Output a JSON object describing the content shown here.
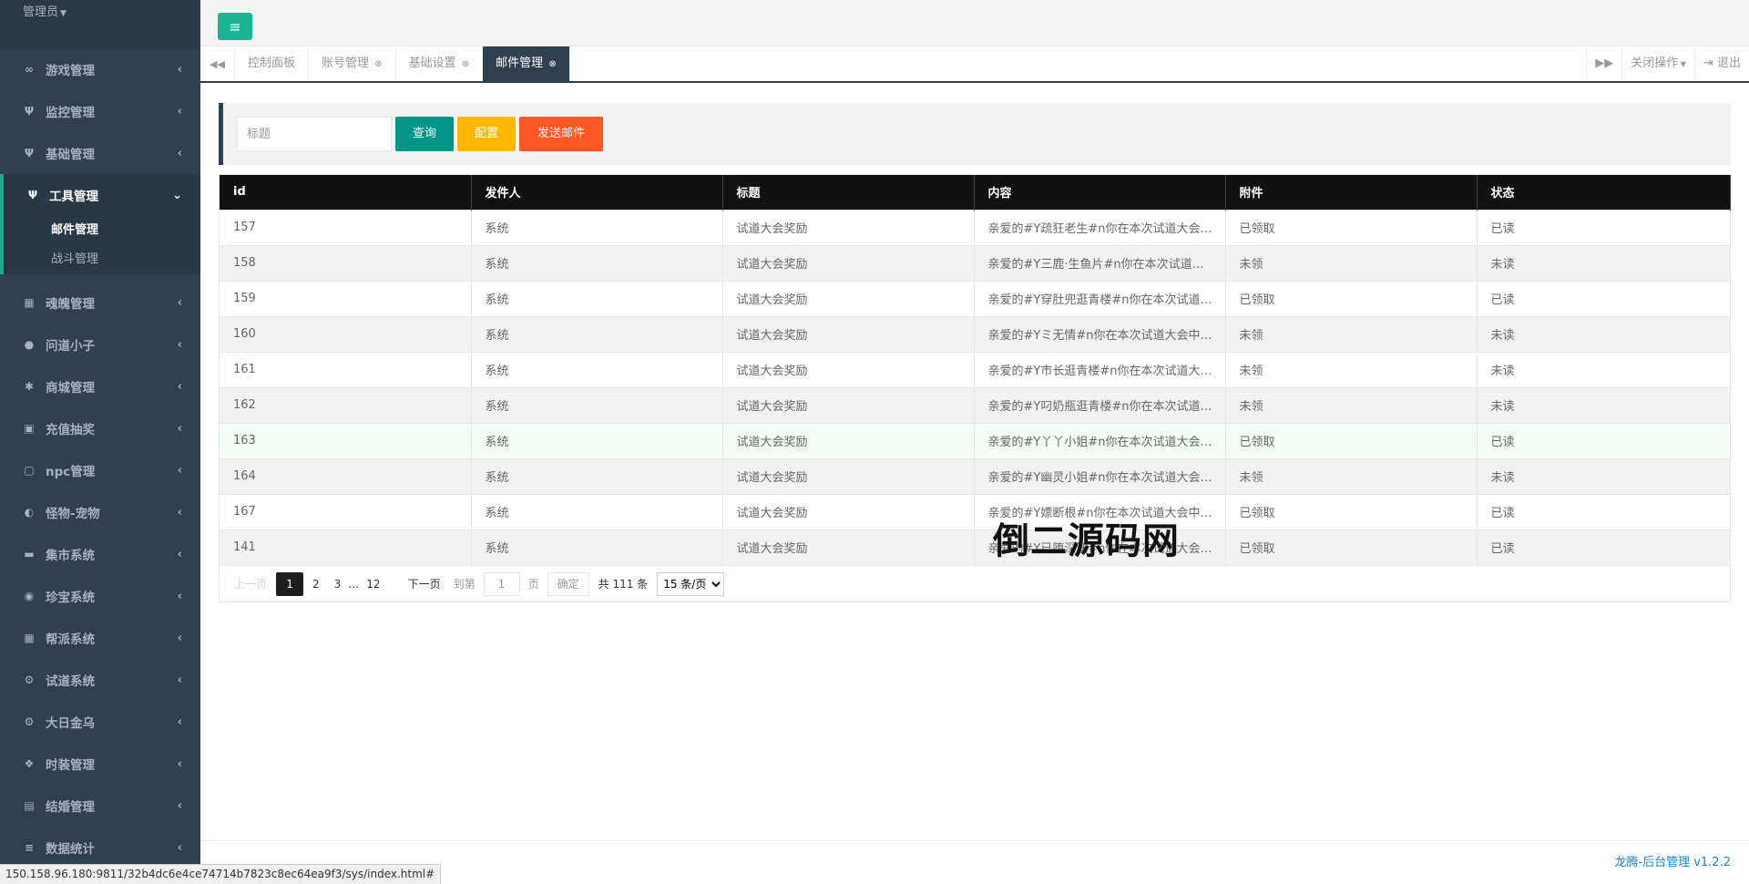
{
  "sidebar": {
    "admin_label": "管理员",
    "items": [
      {
        "label": "游戏管理",
        "icon": "gamepad-icon",
        "glyph": "∞"
      },
      {
        "label": "监控管理",
        "icon": "cutlery-icon",
        "glyph": "Ψ"
      },
      {
        "label": "基础管理",
        "icon": "cutlery-icon",
        "glyph": "Ψ"
      }
    ],
    "open_item": {
      "label": "工具管理",
      "icon": "cutlery-icon",
      "glyph": "Ψ",
      "children": [
        "邮件管理",
        "战斗管理"
      ]
    },
    "items_after": [
      {
        "label": "魂魄管理",
        "icon": "table-icon",
        "glyph": "▦"
      },
      {
        "label": "问道小子",
        "icon": "user-icon",
        "glyph": "●"
      },
      {
        "label": "商城管理",
        "icon": "gear-icon",
        "glyph": "✱"
      },
      {
        "label": "充值抽奖",
        "icon": "money-icon",
        "glyph": "▣"
      },
      {
        "label": "npc管理",
        "icon": "square-icon",
        "glyph": "▢"
      },
      {
        "label": "怪物-宠物",
        "icon": "adjust-icon",
        "glyph": "◐"
      },
      {
        "label": "集市系统",
        "icon": "bed-icon",
        "glyph": "▬"
      },
      {
        "label": "珍宝系统",
        "icon": "target-icon",
        "glyph": "◉"
      },
      {
        "label": "帮派系统",
        "icon": "table-icon",
        "glyph": "▦"
      },
      {
        "label": "试道系统",
        "icon": "cogs-icon",
        "glyph": "⚙"
      },
      {
        "label": "大日金乌",
        "icon": "cogs-icon",
        "glyph": "⚙"
      },
      {
        "label": "时装管理",
        "icon": "cubes-icon",
        "glyph": "❖"
      },
      {
        "label": "结婚管理",
        "icon": "book-icon",
        "glyph": "▤"
      },
      {
        "label": "数据统计",
        "icon": "database-icon",
        "glyph": "≡"
      }
    ]
  },
  "tabs": {
    "items": [
      {
        "label": "控制面板",
        "closable": false
      },
      {
        "label": "账号管理",
        "closable": true
      },
      {
        "label": "基础设置",
        "closable": true
      },
      {
        "label": "邮件管理",
        "closable": true,
        "active": true
      }
    ],
    "close_ops": "关闭操作",
    "logout": "退出"
  },
  "search": {
    "placeholder": "标题",
    "query_btn": "查询",
    "config_btn": "配置",
    "send_btn": "发送邮件"
  },
  "table": {
    "headers": [
      "id",
      "发件人",
      "标题",
      "内容",
      "附件",
      "状态"
    ],
    "rows": [
      [
        "157",
        "系统",
        "试道大会奖励",
        "亲爱的#Y疏狂老生#n你在本次试道大会中表现出色，特此奖励",
        "已领取",
        "已读"
      ],
      [
        "158",
        "系统",
        "试道大会奖励",
        "亲爱的#Y三鹿·生鱼片#n你在本次试道大会中表现出色",
        "未领",
        "未读"
      ],
      [
        "159",
        "系统",
        "试道大会奖励",
        "亲爱的#Y穿肚兜逛青楼#n你在本次试道大会中表现出色",
        "已领取",
        "已读"
      ],
      [
        "160",
        "系统",
        "试道大会奖励",
        "亲爱的#Yミ无情#n你在本次试道大会中表现出色",
        "未领",
        "未读"
      ],
      [
        "161",
        "系统",
        "试道大会奖励",
        "亲爱的#Y市长逛青楼#n你在本次试道大会中表现出色",
        "未领",
        "未读"
      ],
      [
        "162",
        "系统",
        "试道大会奖励",
        "亲爱的#Y叼奶瓶逛青楼#n你在本次试道大会中表现出色",
        "未领",
        "未读"
      ],
      [
        "163",
        "系统",
        "试道大会奖励",
        "亲爱的#Y丫丫小姐#n你在本次试道大会中表现出色",
        "已领取",
        "已读"
      ],
      [
        "164",
        "系统",
        "试道大会奖励",
        "亲爱的#Y幽灵小姐#n你在本次试道大会中表现出色",
        "未领",
        "未读"
      ],
      [
        "167",
        "系统",
        "试道大会奖励",
        "亲爱的#Y嫖断根#n你在本次试道大会中表现出色",
        "已领取",
        "已读"
      ],
      [
        "141",
        "系统",
        "试道大会奖励",
        "亲爱的#Y已堕深渊#n你在本次试道大会中表现出色",
        "已领取",
        "已读"
      ]
    ]
  },
  "pager": {
    "prev": "上一页",
    "pages": [
      "1",
      "2",
      "3"
    ],
    "ellipsis": "…",
    "last": "12",
    "next": "下一页",
    "goto": "到第",
    "goto_value": "1",
    "page_unit": "页",
    "confirm": "确定",
    "total": "共 111 条",
    "per_page": "15 条/页"
  },
  "watermark": "倒二源码网",
  "footer": {
    "version": "龙腾-后台管理 v1.2.2"
  },
  "status_url": "150.158.96.180:9811/32b4dc6e4ce74714b7823c8ec64ea9f3/sys/index.html#"
}
